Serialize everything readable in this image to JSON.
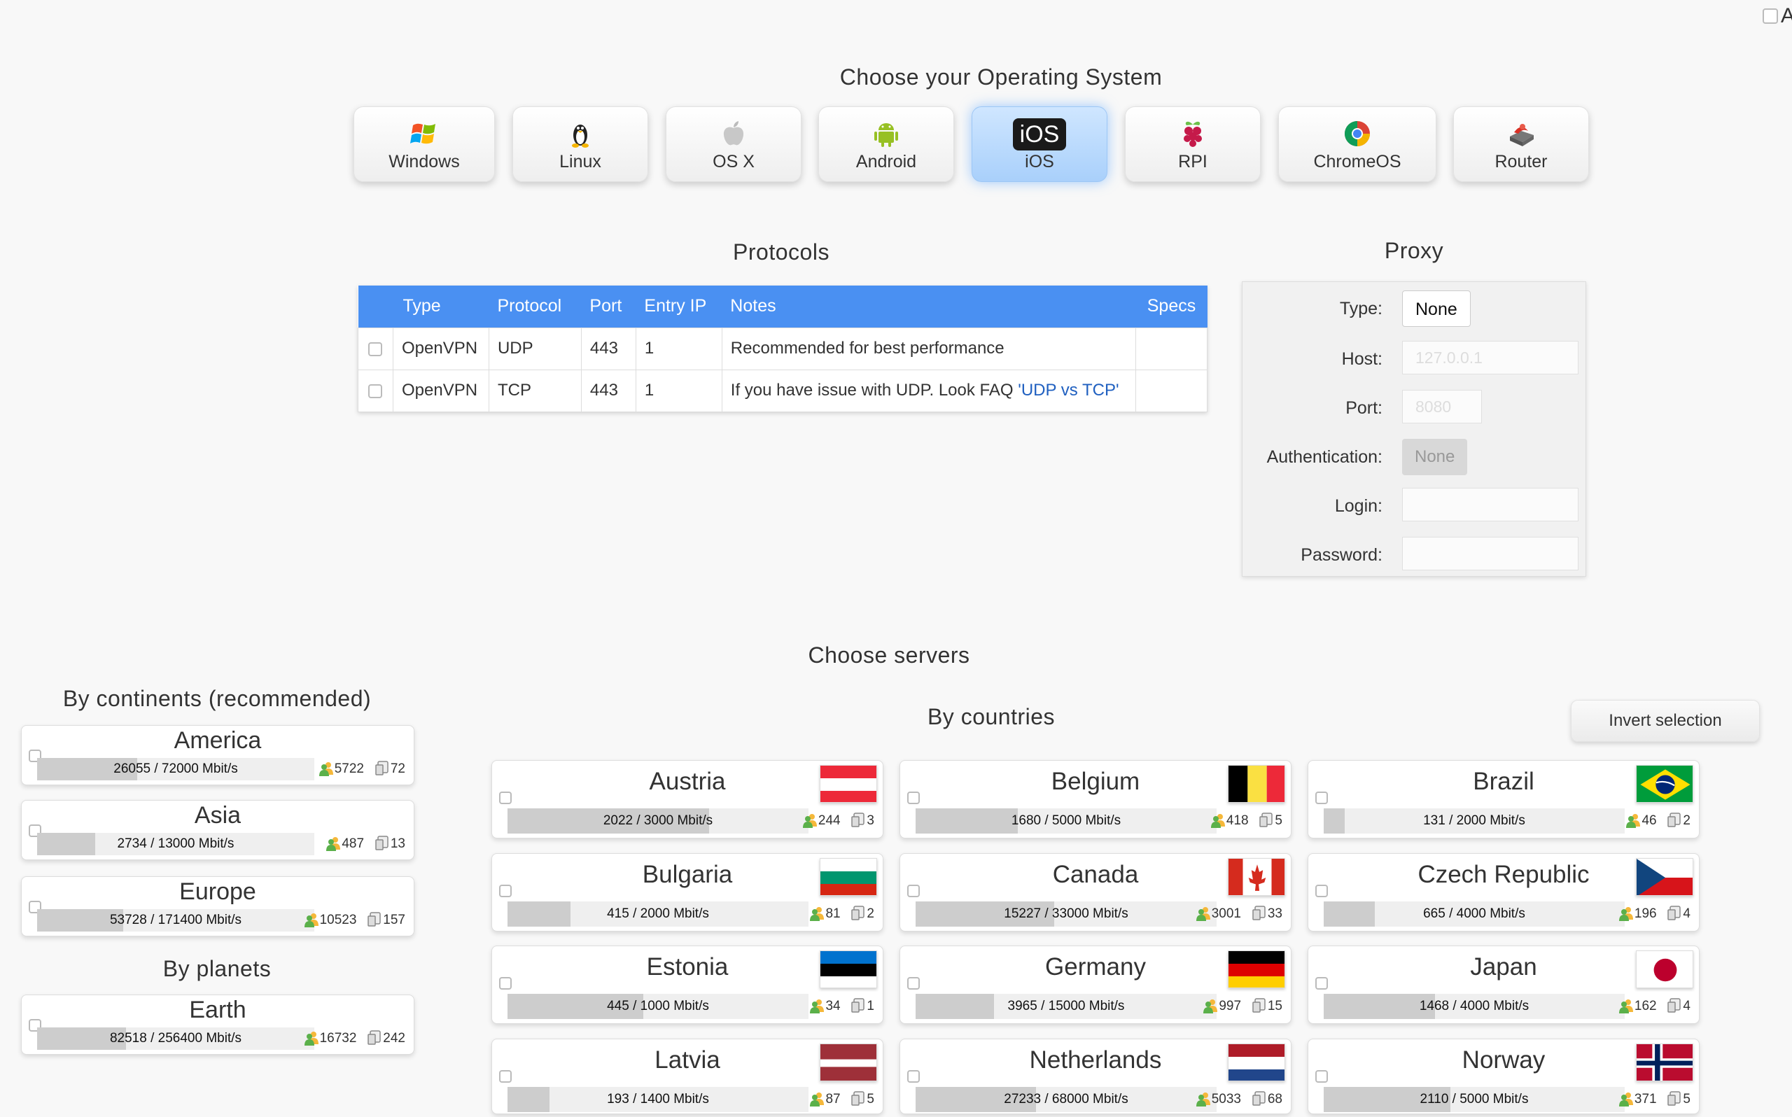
{
  "corner_letter": "A",
  "os_section": {
    "title": "Choose your Operating System",
    "selected": "iOS",
    "items": [
      {
        "key": "windows",
        "label": "Windows"
      },
      {
        "key": "linux",
        "label": "Linux"
      },
      {
        "key": "osx",
        "label": "OS X"
      },
      {
        "key": "android",
        "label": "Android"
      },
      {
        "key": "ios",
        "label": "iOS",
        "icon_text": "iOS"
      },
      {
        "key": "rpi",
        "label": "RPI"
      },
      {
        "key": "chromeos",
        "label": "ChromeOS"
      },
      {
        "key": "router",
        "label": "Router"
      }
    ]
  },
  "protocols": {
    "title": "Protocols",
    "headers": [
      "Type",
      "Protocol",
      "Port",
      "Entry IP",
      "Notes",
      "Specs"
    ],
    "rows": [
      {
        "type": "OpenVPN",
        "protocol": "UDP",
        "port": "443",
        "entry_ip": "1",
        "notes": "Recommended for best performance",
        "link": ""
      },
      {
        "type": "OpenVPN",
        "protocol": "TCP",
        "port": "443",
        "entry_ip": "1",
        "notes": "If you have issue with UDP. Look FAQ ",
        "link": "'UDP vs TCP'"
      }
    ]
  },
  "proxy": {
    "title": "Proxy",
    "type_label": "Type:",
    "type_value": "None",
    "host_label": "Host:",
    "host_placeholder": "127.0.0.1",
    "port_label": "Port:",
    "port_placeholder": "8080",
    "auth_label": "Authentication:",
    "auth_value": "None",
    "login_label": "Login:",
    "password_label": "Password:"
  },
  "servers": {
    "title": "Choose servers",
    "continents_title": "By continents (recommended)",
    "planets_title": "By planets",
    "countries_title": "By countries",
    "invert_label": "Invert selection",
    "continents": [
      {
        "name": "America",
        "bw": "26055 / 72000 Mbit/s",
        "load": 0.362,
        "users": "5722",
        "servers": "72"
      },
      {
        "name": "Asia",
        "bw": "2734 / 13000 Mbit/s",
        "load": 0.21,
        "users": "487",
        "servers": "13"
      },
      {
        "name": "Europe",
        "bw": "53728 / 171400 Mbit/s",
        "load": 0.313,
        "users": "10523",
        "servers": "157"
      }
    ],
    "planets": [
      {
        "name": "Earth",
        "bw": "82518 / 256400 Mbit/s",
        "load": 0.322,
        "users": "16732",
        "servers": "242"
      }
    ],
    "countries": [
      {
        "name": "Austria",
        "bw": "2022 / 3000 Mbit/s",
        "load": 0.674,
        "users": "244",
        "servers": "3",
        "flag": "austria"
      },
      {
        "name": "Belgium",
        "bw": "1680 / 5000 Mbit/s",
        "load": 0.336,
        "users": "418",
        "servers": "5",
        "flag": "belgium"
      },
      {
        "name": "Brazil",
        "bw": "131 / 2000 Mbit/s",
        "load": 0.066,
        "users": "46",
        "servers": "2",
        "flag": "brazil"
      },
      {
        "name": "Bulgaria",
        "bw": "415 / 2000 Mbit/s",
        "load": 0.208,
        "users": "81",
        "servers": "2",
        "flag": "bulgaria"
      },
      {
        "name": "Canada",
        "bw": "15227 / 33000 Mbit/s",
        "load": 0.461,
        "users": "3001",
        "servers": "33",
        "flag": "canada"
      },
      {
        "name": "Czech Republic",
        "bw": "665 / 4000 Mbit/s",
        "load": 0.166,
        "users": "196",
        "servers": "4",
        "flag": "czech"
      },
      {
        "name": "Estonia",
        "bw": "445 / 1000 Mbit/s",
        "load": 0.445,
        "users": "34",
        "servers": "1",
        "flag": "estonia"
      },
      {
        "name": "Germany",
        "bw": "3965 / 15000 Mbit/s",
        "load": 0.264,
        "users": "997",
        "servers": "15",
        "flag": "germany"
      },
      {
        "name": "Japan",
        "bw": "1468 / 4000 Mbit/s",
        "load": 0.367,
        "users": "162",
        "servers": "4",
        "flag": "japan"
      },
      {
        "name": "Latvia",
        "bw": "193 / 1400 Mbit/s",
        "load": 0.138,
        "users": "87",
        "servers": "5",
        "flag": "latvia"
      },
      {
        "name": "Netherlands",
        "bw": "27233 / 68000 Mbit/s",
        "load": 0.4,
        "users": "5033",
        "servers": "68",
        "flag": "netherlands"
      },
      {
        "name": "Norway",
        "bw": "2110 / 5000 Mbit/s",
        "load": 0.422,
        "users": "371",
        "servers": "5",
        "flag": "norway"
      }
    ]
  },
  "colors": {
    "header_blue": "#4a90f2",
    "selected_blue": "#a9d0fb",
    "bar_fill": "#cdcdcd"
  }
}
